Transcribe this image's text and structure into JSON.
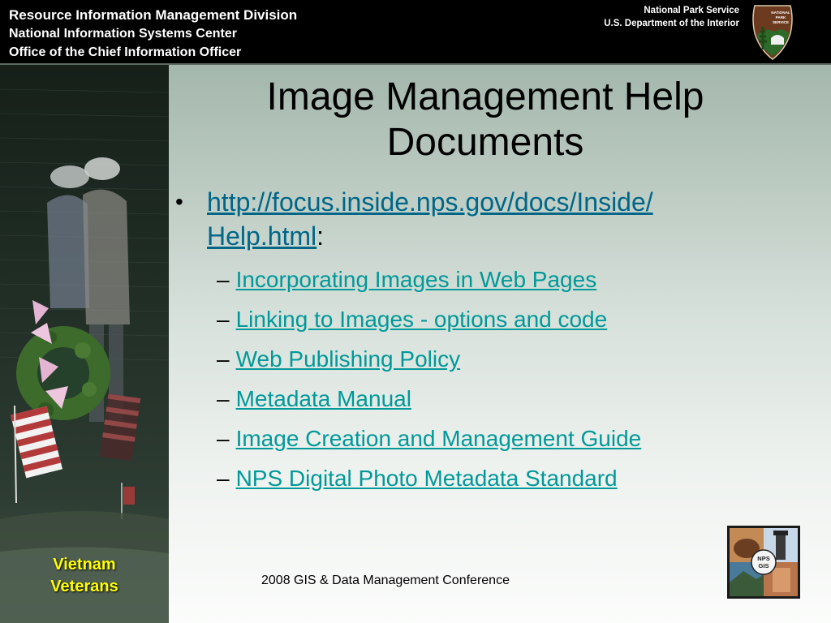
{
  "header": {
    "left_lines": [
      "Resource Information Management Division",
      "National Information Systems Center",
      "Office of the Chief Information Officer"
    ],
    "right_lines": [
      "National Park Service",
      "U.S. Department of the Interior"
    ],
    "logo_icon": "nps-arrowhead-logo",
    "logo_text": "NATIONAL PARK SERVICE"
  },
  "photo": {
    "caption_lines": [
      "Vietnam",
      "Veterans"
    ],
    "caption_color": "#ffff00"
  },
  "title_lines": [
    "Image Management Help",
    "Documents"
  ],
  "bullets": {
    "main_link": "http://focus.inside.nps.gov/docs/Inside/Help.html",
    "main_link_line1": "http://focus.inside.nps.gov/docs/Inside/",
    "main_link_line2": "Help.html",
    "main_suffix": ":",
    "dash": "–",
    "sub_links": [
      "Incorporating Images in Web Pages",
      "Linking to Images - options and code",
      "Web Publishing Policy",
      "Metadata Manual",
      "Image Creation and Management Guide",
      "NPS Digital Photo Metadata Standard"
    ]
  },
  "footer": {
    "conference": "2008 GIS & Data Management Conference",
    "logo_icon": "nps-gis-logo",
    "logo_text": "NPS GIS"
  },
  "colors": {
    "header_bg": "#000000",
    "link": "#009999",
    "caption": "#ffff00"
  }
}
